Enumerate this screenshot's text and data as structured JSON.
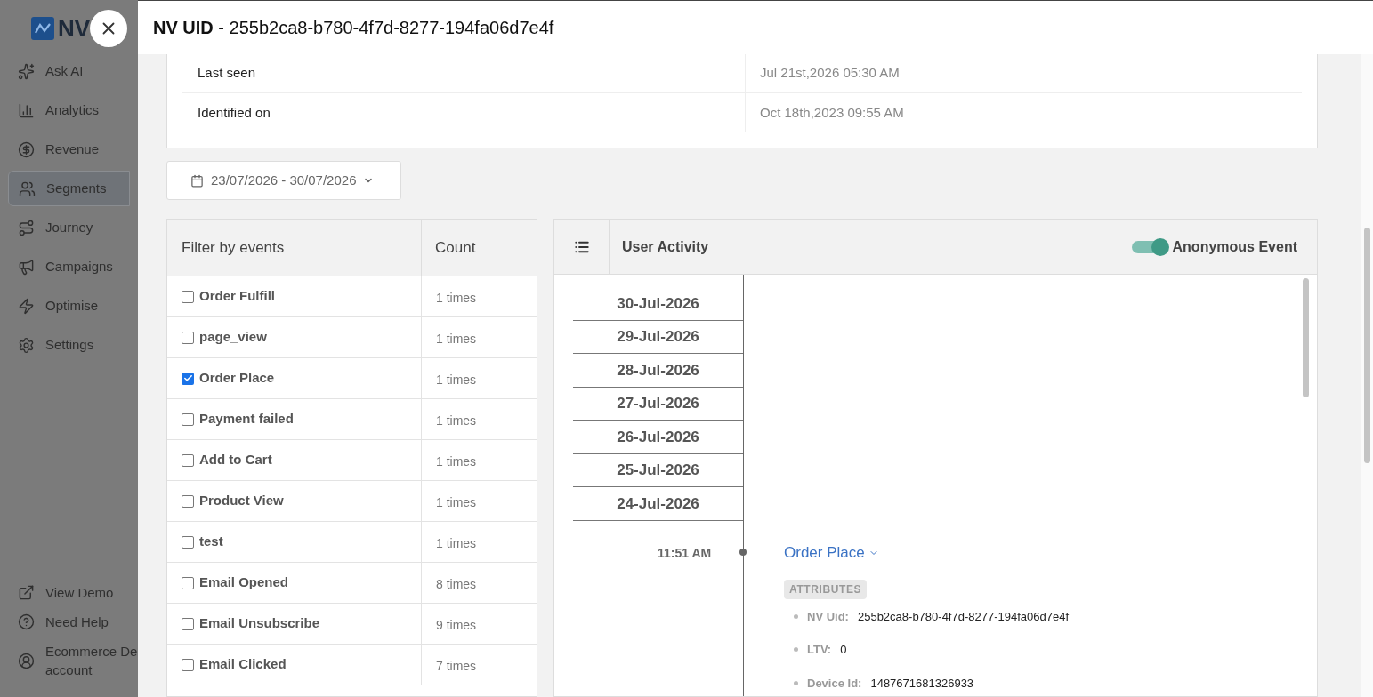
{
  "sidebar": {
    "logo": "NV",
    "items": [
      {
        "label": "Ask AI",
        "selected": false
      },
      {
        "label": "Analytics",
        "selected": false
      },
      {
        "label": "Revenue",
        "selected": false
      },
      {
        "label": "Segments",
        "selected": true
      },
      {
        "label": "Journey",
        "selected": false
      },
      {
        "label": "Campaigns",
        "selected": false
      },
      {
        "label": "Optimise",
        "selected": false
      },
      {
        "label": "Settings",
        "selected": false
      }
    ],
    "bottom_items": [
      {
        "label": "View Demo"
      },
      {
        "label": "Need Help"
      },
      {
        "label": "Ecommerce De\naccount"
      }
    ]
  },
  "drawer": {
    "title": "**NV UID** - 255b2ca8-b780-4f7d-8277-194fa06d7e4f",
    "details": [
      {
        "label": "Last seen",
        "value": "Jul 21st,2026 05:30 AM"
      },
      {
        "label": "Identified on",
        "value": "Oct 18th,2023 09:55 AM"
      }
    ],
    "date_range": "23/07/2026 - 30/07/2026",
    "filter_table": {
      "columns": [
        "Filter by events",
        "Count"
      ],
      "rows": [
        {
          "event": "Order Fulfill",
          "count": "1 times",
          "checked": false
        },
        {
          "event": "page_view",
          "count": "1 times",
          "checked": false
        },
        {
          "event": "Order Place",
          "count": "1 times",
          "checked": true
        },
        {
          "event": "Payment failed",
          "count": "1 times",
          "checked": false
        },
        {
          "event": "Add to Cart",
          "count": "1 times",
          "checked": false
        },
        {
          "event": "Product View",
          "count": "1 times",
          "checked": false
        },
        {
          "event": "test",
          "count": "1 times",
          "checked": false
        },
        {
          "event": "Email Opened",
          "count": "8 times",
          "checked": false
        },
        {
          "event": "Email Unsubscribe",
          "count": "9 times",
          "checked": false
        },
        {
          "event": "Email Clicked",
          "count": "7 times",
          "checked": false
        }
      ]
    },
    "activity": {
      "title": "User Activity",
      "anonymous_toggle": {
        "label": "Anonymous Event",
        "on": true
      },
      "dates": [
        "30-Jul-2026",
        "29-Jul-2026",
        "28-Jul-2026",
        "27-Jul-2026",
        "26-Jul-2026",
        "25-Jul-2026",
        "24-Jul-2026"
      ],
      "events": [
        {
          "time": "11:51 AM",
          "name": "Order Place",
          "badge": "ATTRIBUTES",
          "attributes": [
            {
              "key": "NV Uid:",
              "value": "255b2ca8-b780-4f7d-8277-194fa06d7e4f"
            },
            {
              "key": "LTV:",
              "value": "0"
            },
            {
              "key": "Device Id:",
              "value": "1487671681326933"
            }
          ]
        }
      ]
    }
  }
}
